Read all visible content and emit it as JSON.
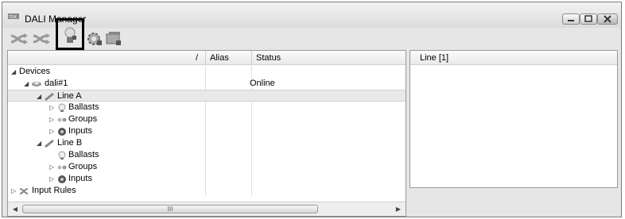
{
  "window": {
    "title": "DALI Manager",
    "app_icon_text": "TDK"
  },
  "toolbar": {
    "buttons": [
      {
        "name": "shuffle-icon"
      },
      {
        "name": "shuffle-alt-icon"
      },
      {
        "name": "ballast-bulb-icon",
        "selected": true
      },
      {
        "name": "gear-settings-icon"
      },
      {
        "name": "device-config-icon"
      }
    ]
  },
  "tree": {
    "columns": [
      "Alias",
      "Status"
    ],
    "sort_glyph": "/",
    "rows": [
      {
        "label": "Devices",
        "status": ""
      },
      {
        "label": "dali#1",
        "status": "Online"
      },
      {
        "label": "Line A",
        "status": "",
        "selected": true
      },
      {
        "label": "Ballasts",
        "status": ""
      },
      {
        "label": "Groups",
        "status": ""
      },
      {
        "label": "Inputs",
        "status": ""
      },
      {
        "label": "Line B",
        "status": ""
      },
      {
        "label": "Ballasts",
        "status": ""
      },
      {
        "label": "Groups",
        "status": ""
      },
      {
        "label": "Inputs",
        "status": ""
      },
      {
        "label": "Input Rules",
        "status": ""
      }
    ]
  },
  "scrollbar": {
    "left_arrow": "◀",
    "right_arrow": "▶",
    "grip": "III"
  },
  "right_panel": {
    "header": "Line [1]"
  },
  "colors": {
    "window_bg": "#e6e6e6",
    "selected_row": "#e9e9e9"
  }
}
